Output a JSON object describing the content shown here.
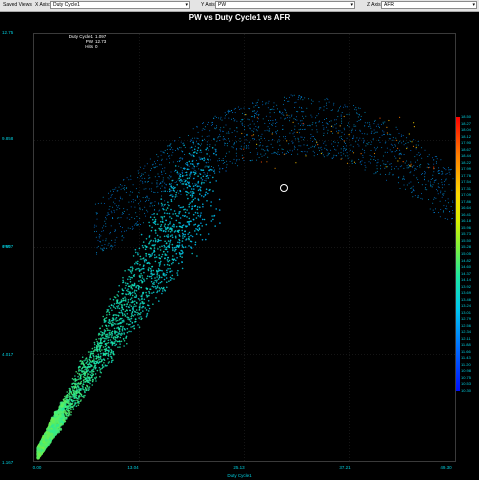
{
  "toolbar": {
    "saved_views_label": "Saved Views",
    "x_axis_label": "X Axis:",
    "x_axis_value": "Duty Cycle1",
    "y_axis_label": "Y Axis:",
    "y_axis_value": "PW",
    "z_axis_label": "Z Axis:",
    "z_axis_value": "AFR"
  },
  "chart_data": {
    "type": "scatter",
    "title": "PW vs Duty Cycle1 vs AFR",
    "xlabel": "Duty Cycle1",
    "ylabel": "PW",
    "x_ticks": [
      "0.00",
      "13.04",
      "25.13",
      "37.21",
      "49.30"
    ],
    "y_ticks": [
      "12.75",
      "9.858",
      "6.907",
      "4.017",
      "1.167"
    ],
    "xlim": [
      0.0,
      49.3
    ],
    "ylim": [
      1.167,
      12.75
    ],
    "zlim": [
      10.3,
      18.5
    ],
    "colorbar_labels": [
      "18.50",
      "18.27",
      "18.04",
      "18.12",
      "17.90",
      "18.67",
      "18.44",
      "18.22",
      "17.99",
      "17.76",
      "17.54",
      "17.31",
      "17.09",
      "17.86",
      "16.64",
      "16.41",
      "16.18",
      "15.96",
      "15.73",
      "15.50",
      "15.28",
      "15.05",
      "14.82",
      "14.60",
      "14.37",
      "14.14",
      "13.92",
      "13.69",
      "13.46",
      "13.24",
      "13.01",
      "12.79",
      "12.56",
      "12.34",
      "12.11",
      "11.88",
      "11.66",
      "11.43",
      "11.20",
      "10.98",
      "10.75",
      "10.53",
      "10.30"
    ],
    "grid": true,
    "cursor_info": {
      "duty_cycle_label": "Duty Cycle1",
      "duty_cycle_value": "1.097",
      "pw_label": "PW",
      "pw_value": "12.73",
      "hits_label": "Hits",
      "hits_value": "0"
    }
  }
}
